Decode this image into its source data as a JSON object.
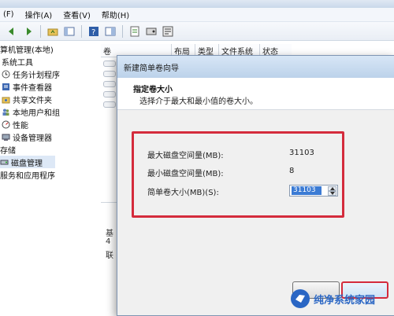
{
  "menubar": {
    "items": [
      "操作(A)",
      "查看(V)",
      "帮助(H)"
    ],
    "partial_item": "(F)"
  },
  "tree": {
    "items": [
      {
        "label": "算机管理(本地)",
        "icon": "computer-icon"
      },
      {
        "label": "系统工具",
        "icon": ""
      },
      {
        "label": "任务计划程序",
        "icon": "clock-icon"
      },
      {
        "label": "事件查看器",
        "icon": "event-viewer-icon"
      },
      {
        "label": "共享文件夹",
        "icon": "shared-folder-icon"
      },
      {
        "label": "本地用户和组",
        "icon": "users-icon"
      },
      {
        "label": "性能",
        "icon": "performance-icon"
      },
      {
        "label": "设备管理器",
        "icon": "device-manager-icon"
      },
      {
        "label": "存储",
        "icon": ""
      },
      {
        "label": "磁盘管理",
        "icon": "disk-icon"
      },
      {
        "label": "服务和应用程序",
        "icon": ""
      }
    ]
  },
  "listpane": {
    "columns": [
      "卷",
      "布局",
      "类型",
      "文件系统",
      "状态"
    ],
    "lower_chars": [
      "基",
      "4",
      "联"
    ]
  },
  "dialog": {
    "title": "新建简单卷向导",
    "heading": "指定卷大小",
    "subheading": "选择介于最大和最小值的卷大小。",
    "max_label": "最大磁盘空间量(MB):",
    "max_value": "31103",
    "min_label": "最小磁盘空间量(MB):",
    "min_value": "8",
    "size_label": "简单卷大小(MB)(S):",
    "size_value": "31103"
  },
  "watermark": {
    "text": "纯净系统家园"
  },
  "colors": {
    "highlight_red": "#d42b3c",
    "selection_blue": "#3b7bd4",
    "title_blue": "#bcd2ea"
  }
}
